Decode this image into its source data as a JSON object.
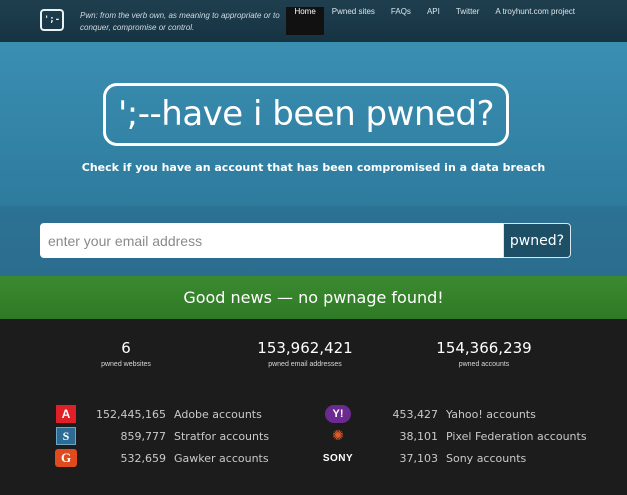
{
  "header": {
    "logo_text": "';-",
    "tagline": "Pwn: from the verb own, as meaning to appropriate or to conquer, compromise or control.",
    "nav": [
      {
        "label": "Home",
        "active": true
      },
      {
        "label": "Pwned sites",
        "active": false
      },
      {
        "label": "FAQs",
        "active": false
      },
      {
        "label": "API",
        "active": false
      },
      {
        "label": "Twitter",
        "active": false
      },
      {
        "label": "A troyhunt.com project",
        "active": false
      }
    ]
  },
  "hero": {
    "title": "';--have i been pwned?",
    "subtitle": "Check if you have an account that has been compromised in a data breach"
  },
  "search": {
    "value": "",
    "placeholder": "enter your email address",
    "button_label": "pwned?"
  },
  "result": {
    "message": "Good news — no pwnage found!",
    "color": "#3b8a30"
  },
  "stats": [
    {
      "value": "6",
      "label": "pwned websites"
    },
    {
      "value": "153,962,421",
      "label": "pwned email addresses"
    },
    {
      "value": "154,366,239",
      "label": "pwned accounts"
    }
  ],
  "breaches_left": [
    {
      "icon": "adobe-icon",
      "glyph": "A",
      "count": "152,445,165",
      "name": "Adobe accounts"
    },
    {
      "icon": "stratfor-icon",
      "glyph": "S",
      "count": "859,777",
      "name": "Stratfor accounts"
    },
    {
      "icon": "gawker-icon",
      "glyph": "G",
      "count": "532,659",
      "name": "Gawker accounts"
    }
  ],
  "breaches_right": [
    {
      "icon": "yahoo-icon",
      "glyph": "Y!",
      "count": "453,427",
      "name": "Yahoo! accounts"
    },
    {
      "icon": "pixel-federation-icon",
      "glyph": "✺",
      "count": "38,101",
      "name": "Pixel Federation accounts"
    },
    {
      "icon": "sony-icon",
      "glyph": "SONY",
      "count": "37,103",
      "name": "Sony accounts"
    }
  ]
}
